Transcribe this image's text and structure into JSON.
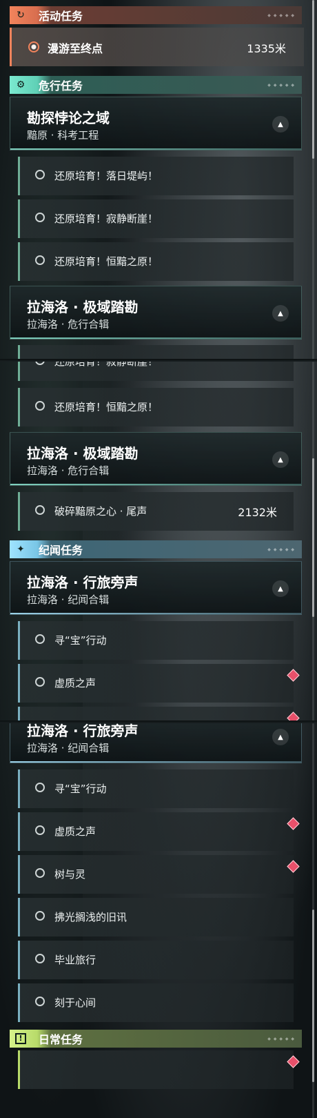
{
  "categories": {
    "active": {
      "label": "活动任务",
      "icon": "refresh-arrow-icon"
    },
    "danger": {
      "label": "危行任务",
      "icon": "gear-badge-icon"
    },
    "lore": {
      "label": "纪闻任务",
      "icon": "sparkle-icon"
    },
    "daily": {
      "label": "日常任务",
      "icon": "exclamation-icon"
    }
  },
  "active_quest": {
    "title": "漫游至终点",
    "distance": "1335米"
  },
  "groups": {
    "kankan": {
      "title": "勘探悖论之域",
      "subtitle": "黯原 · 科考工程"
    },
    "lahailuo_danger": {
      "title": "拉海洛 · 极域踏勘",
      "subtitle": "拉海洛 · 危行合辑"
    },
    "lahailuo_lore": {
      "title": "拉海洛 · 行旅旁声",
      "subtitle": "拉海洛 · 纪闻合辑"
    }
  },
  "quests": {
    "q1": "还原培育！落日堤屿！",
    "q2": "还原培育！寂静断崖！",
    "q3": "还原培育！恒黯之原！",
    "q4": "破碎黯原之心 · 尾声",
    "q4_distance": "2132米",
    "q5": "寻“宝”行动",
    "q6": "虚质之声",
    "q7": "树与灵",
    "q8": "拂光搁浅的旧讯",
    "q9": "毕业旅行",
    "q10": "刻于心间"
  },
  "colors": {
    "active": "#f2845c",
    "danger": "#7bead0",
    "lore": "#9fe3ff",
    "daily": "#d6f28a",
    "tracked_marker": "#e8506a"
  }
}
